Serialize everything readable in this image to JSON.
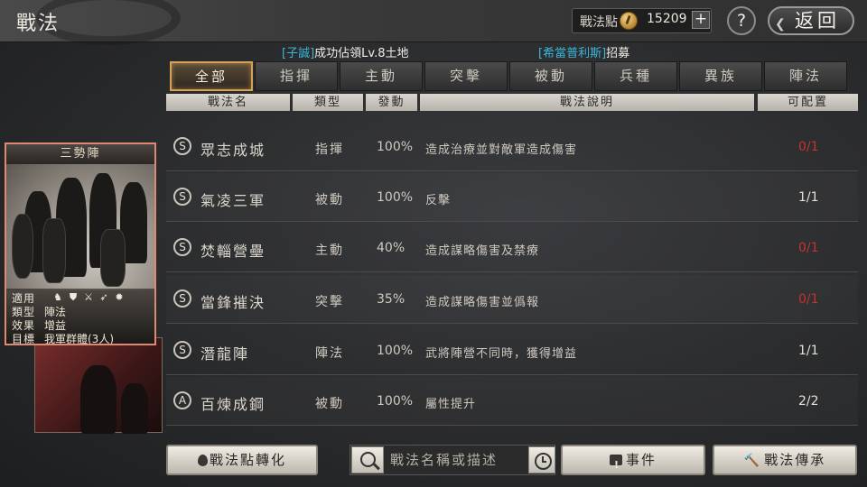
{
  "header": {
    "title": "戰法",
    "points_label": "戰法點",
    "points_value": "15209",
    "plus_label": "+",
    "help_label": "?",
    "return_label": "返回",
    "return_arrow": "❮"
  },
  "ticker": [
    {
      "tag": "[子誠]",
      "text": "成功佔領Lv.8土地"
    },
    {
      "tag": "[希當普利斯]",
      "text": "招募"
    }
  ],
  "tabs": [
    "全部",
    "指揮",
    "主動",
    "突擊",
    "被動",
    "兵種",
    "異族",
    "陣法"
  ],
  "active_tab": "全部",
  "columns": {
    "name": "戰法名",
    "type": "類型",
    "trigger": "發動",
    "desc": "戰法說明",
    "cap": "可配置"
  },
  "rows": [
    {
      "grade": "S",
      "name": "眾志成城",
      "type": "指揮",
      "pct": "100%",
      "desc": "造成治療並對敵軍造成傷害",
      "cap": "0/1",
      "cap_full": true
    },
    {
      "grade": "S",
      "name": "氣凌三軍",
      "type": "被動",
      "pct": "100%",
      "desc": "反擊",
      "cap": "1/1",
      "cap_full": false
    },
    {
      "grade": "S",
      "name": "焚輜營壘",
      "type": "主動",
      "pct": "40%",
      "desc": "造成謀略傷害及禁療",
      "cap": "0/1",
      "cap_full": true
    },
    {
      "grade": "S",
      "name": "當鋒摧決",
      "type": "突擊",
      "pct": "35%",
      "desc": "造成謀略傷害並僞報",
      "cap": "0/1",
      "cap_full": true
    },
    {
      "grade": "S",
      "name": "潛龍陣",
      "type": "陣法",
      "pct": "100%",
      "desc": "武將陣營不同時，獲得增益",
      "cap": "1/1",
      "cap_full": false
    },
    {
      "grade": "A",
      "name": "百煉成鋼",
      "type": "被動",
      "pct": "100%",
      "desc": "屬性提升",
      "cap": "2/2",
      "cap_full": false
    }
  ],
  "card": {
    "title": "三勢陣",
    "apply_label": "適用",
    "apply_icons": [
      "horse-icon",
      "shield-icon",
      "crossed-swords-icon",
      "bow-icon",
      "wheel-icon"
    ],
    "type_label": "類型",
    "type_value": "陣法",
    "effect_label": "效果",
    "effect_value": "增益",
    "target_label": "目標",
    "target_value": "我軍群體(3人)"
  },
  "bottom": {
    "convert_label": "戰法點轉化",
    "search_placeholder": "戰法名稱或描述",
    "event_label": "事件",
    "inherit_label": "戰法傳承"
  },
  "colors": {
    "accent_gold": "#d7a257",
    "cap_red": "#c6332d",
    "ticker_blue": "#3ab7d8",
    "card_border": "#e08872"
  }
}
